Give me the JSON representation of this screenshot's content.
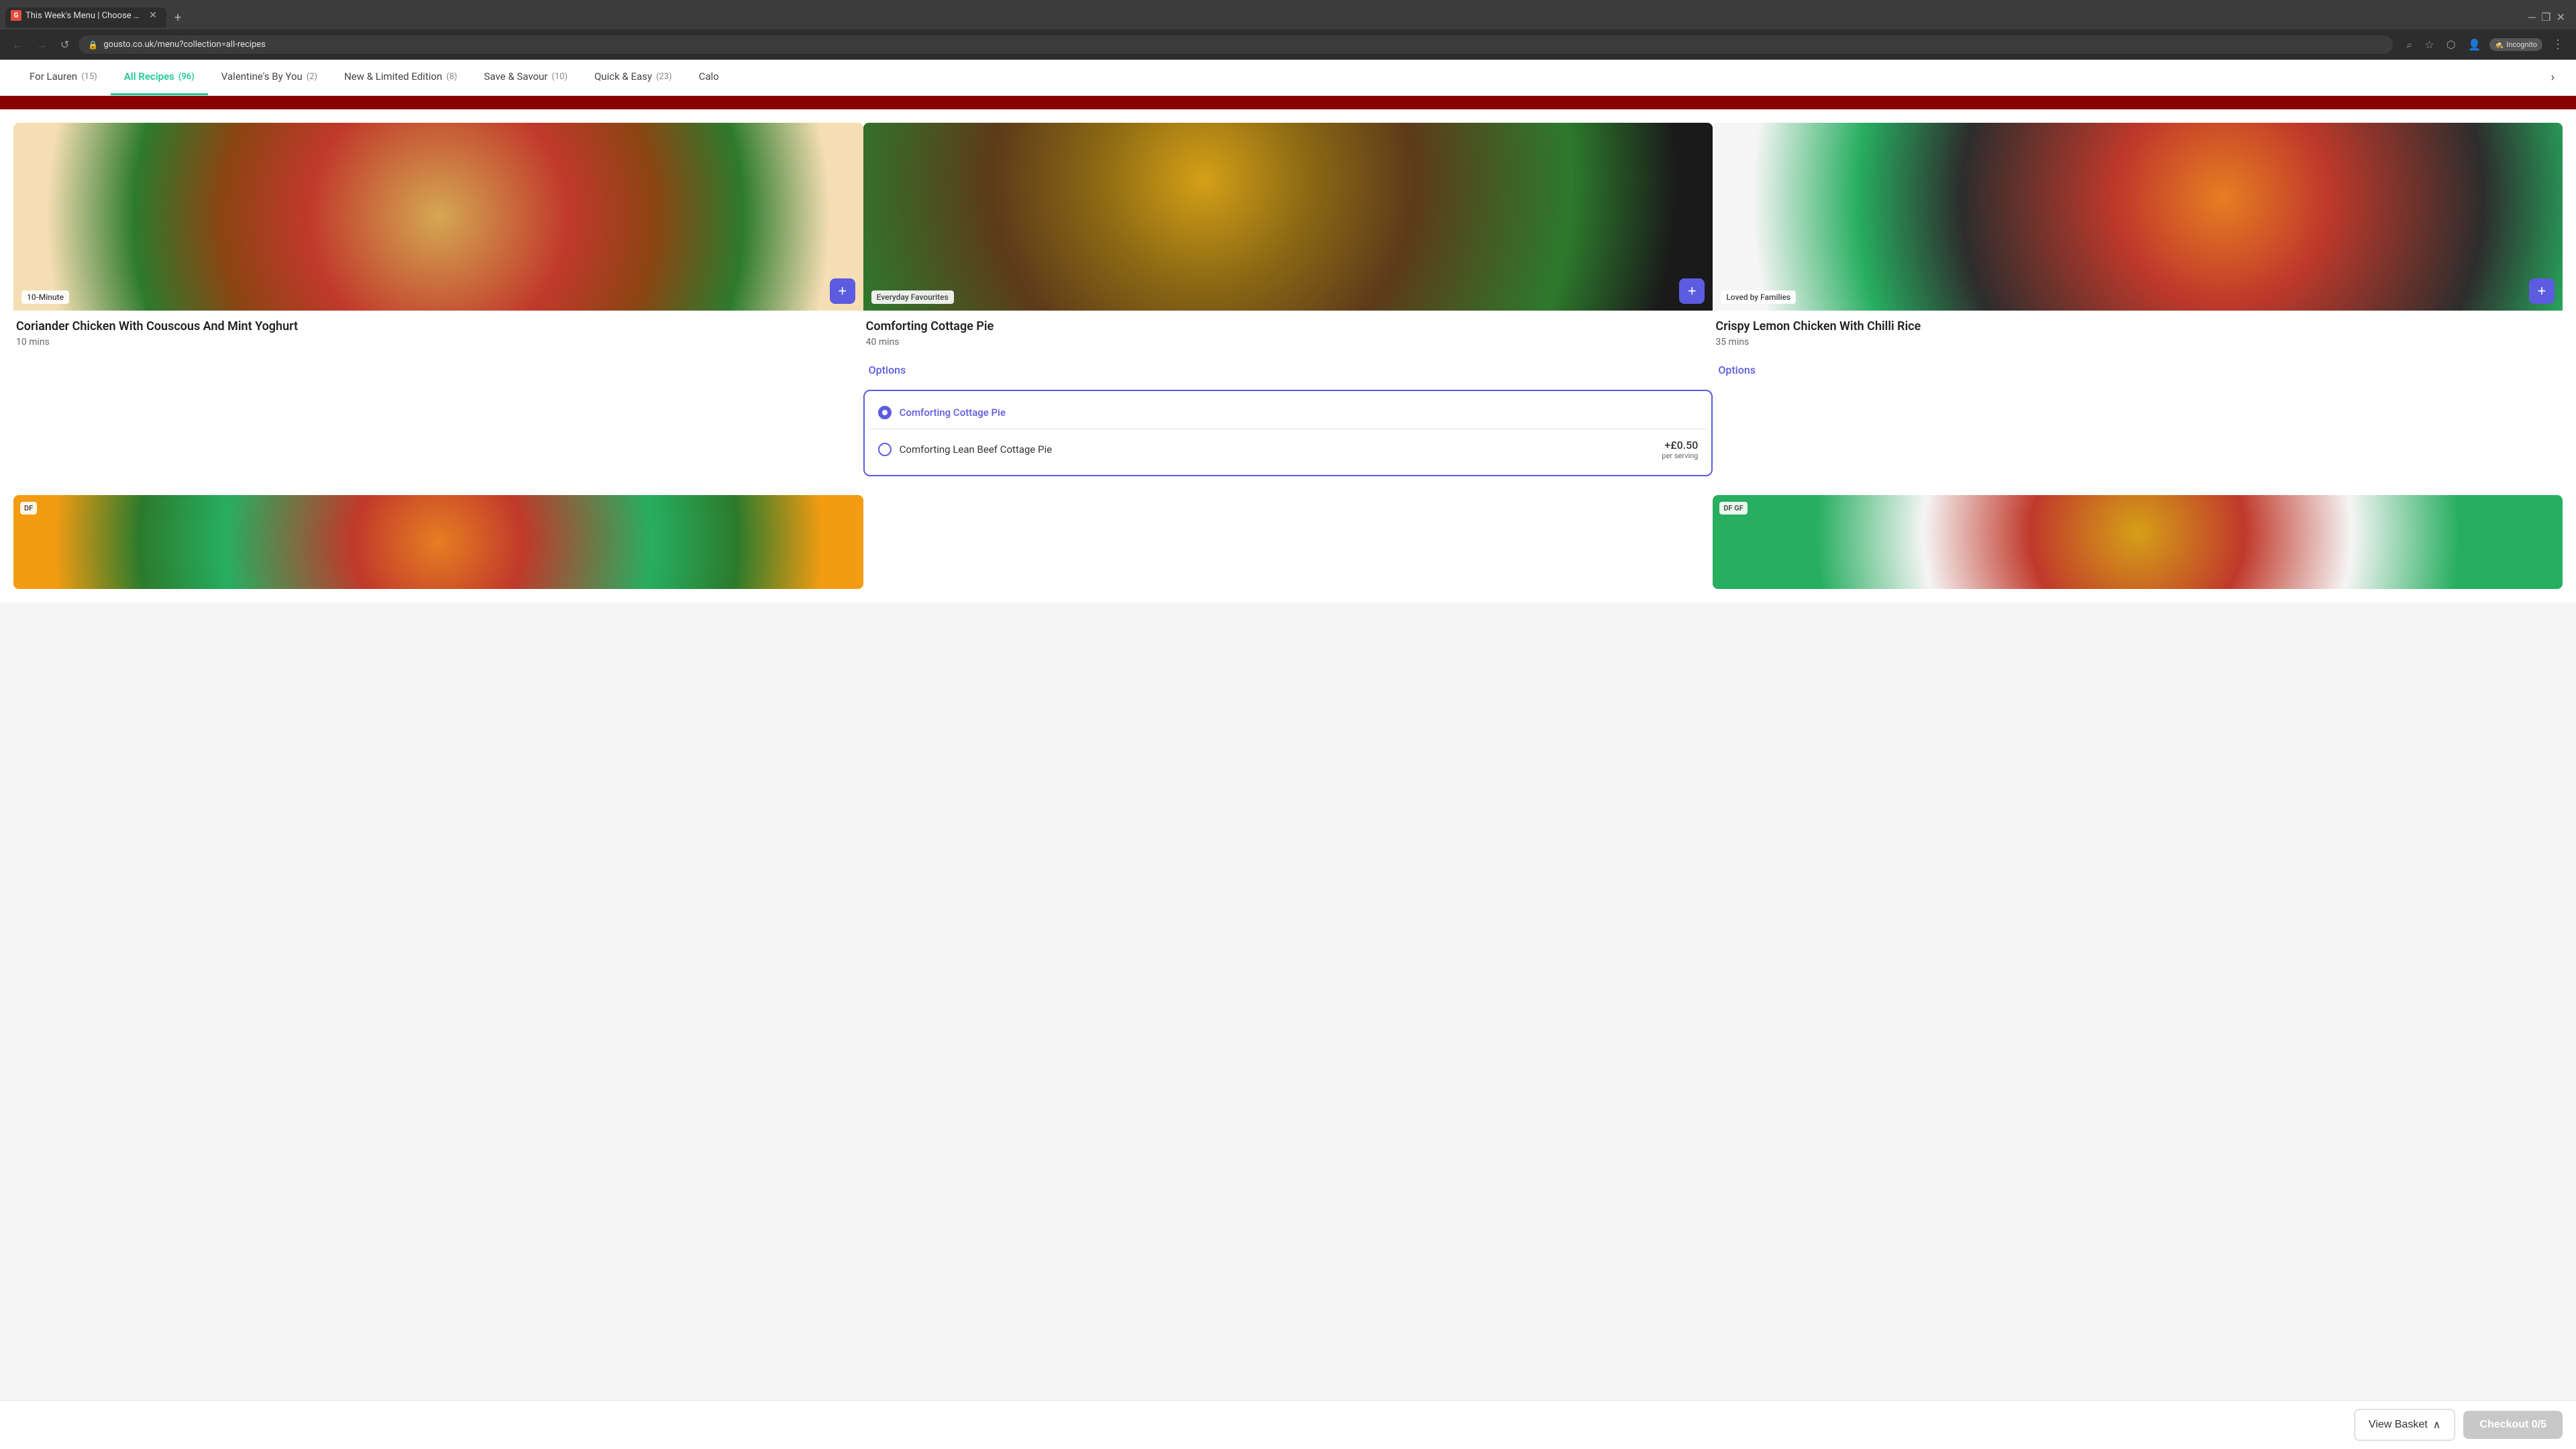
{
  "browser": {
    "tab_title": "This Week's Menu | Choose Fro...",
    "tab_favicon": "G",
    "url": "gousto.co.uk/menu?collection=all-recipes",
    "incognito_label": "Incognito"
  },
  "nav": {
    "categories": [
      {
        "id": "for-lauren",
        "label": "For Lauren",
        "count": "15",
        "active": false
      },
      {
        "id": "all-recipes",
        "label": "All Recipes",
        "count": "96",
        "active": true
      },
      {
        "id": "valentines",
        "label": "Valentine's By You",
        "count": "2",
        "active": false
      },
      {
        "id": "new-limited",
        "label": "New & Limited Edition",
        "count": "8",
        "active": false
      },
      {
        "id": "save-savour",
        "label": "Save & Savour",
        "count": "10",
        "active": false
      },
      {
        "id": "quick-easy",
        "label": "Quick & Easy",
        "count": "23",
        "active": false
      },
      {
        "id": "calorie",
        "label": "Calo",
        "count": "",
        "active": false
      }
    ]
  },
  "recipes": [
    {
      "id": "coriander-chicken",
      "tag": "10-Minute",
      "title": "Coriander Chicken With Couscous And Mint Yoghurt",
      "time": "10 mins",
      "image_class": "dish-couscous",
      "diet_badge": null
    },
    {
      "id": "cottage-pie",
      "tag": "Everyday Favourites",
      "title": "Comforting Cottage Pie",
      "time": "40 mins",
      "image_class": "dish-pie",
      "diet_badge": null,
      "has_options": true
    },
    {
      "id": "crispy-lemon-chicken",
      "tag": "Loved by Families",
      "title": "Crispy Lemon Chicken With Chilli Rice",
      "time": "35 mins",
      "image_class": "dish-chicken",
      "diet_badge": null,
      "has_options_right": true
    }
  ],
  "partial_recipes": [
    {
      "id": "df-salad",
      "image_class": "dish-salad1",
      "diet_badges": [
        "DF"
      ]
    },
    {
      "id": "df-gf-salad",
      "image_class": "dish-salad2",
      "diet_badges": [
        "DF",
        "GF"
      ]
    }
  ],
  "options_popup": {
    "option1": {
      "label": "Comforting Cottage Pie",
      "checked": true
    },
    "option2": {
      "label": "Comforting Lean Beef Cottage Pie",
      "price": "+£0.50",
      "price_sub": "per serving",
      "checked": false
    }
  },
  "bottom_bar": {
    "view_basket_label": "View Basket",
    "checkout_label": "Checkout",
    "checkout_count": "0/5"
  },
  "add_btn_label": "+",
  "options_label": "Options",
  "chevron_right": "›"
}
